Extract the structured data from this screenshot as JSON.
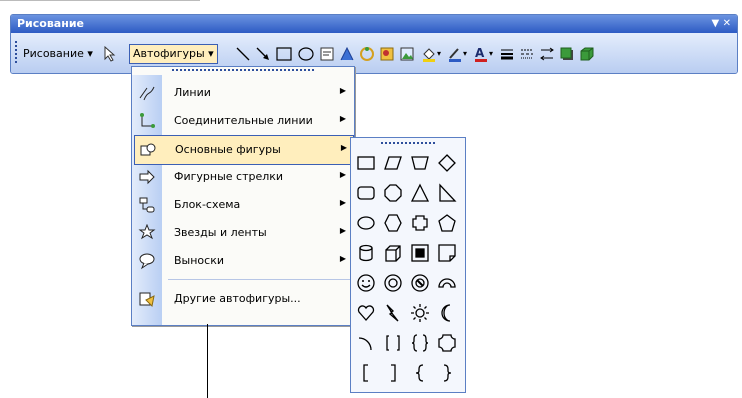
{
  "toolbar": {
    "title": "Рисование",
    "drawing_menu": "Рисование",
    "autoshapes_menu": "Автофигуры",
    "title_controls": "▼ ✕"
  },
  "menu": {
    "items": [
      {
        "label": "Линии",
        "icon": "lines-icon",
        "submenu": true
      },
      {
        "label": "Соединительные линии",
        "icon": "connectors-icon",
        "submenu": true
      },
      {
        "label": "Основные фигуры",
        "icon": "basic-shapes-icon",
        "submenu": true,
        "selected": true
      },
      {
        "label": "Фигурные стрелки",
        "icon": "block-arrows-icon",
        "submenu": true
      },
      {
        "label": "Блок-схема",
        "icon": "flowchart-icon",
        "submenu": true
      },
      {
        "label": "Звезды и ленты",
        "icon": "stars-banners-icon",
        "submenu": true
      },
      {
        "label": "Выноски",
        "icon": "callouts-icon",
        "submenu": true
      },
      {
        "label": "Другие автофигуры...",
        "icon": "more-autoshapes-icon",
        "submenu": false
      }
    ]
  },
  "palette": {
    "shapes": [
      "rectangle",
      "parallelogram",
      "trapezoid",
      "diamond",
      "rounded-rectangle",
      "octagon",
      "isosceles-triangle",
      "right-triangle",
      "oval",
      "hexagon",
      "cross",
      "pentagon",
      "can",
      "cube",
      "bevel",
      "folded-corner",
      "smiley-face",
      "donut",
      "no-symbol",
      "block-arc",
      "heart",
      "lightning-bolt",
      "sun",
      "moon",
      "arc",
      "double-bracket",
      "double-brace",
      "plaque",
      "left-bracket",
      "right-bracket",
      "left-brace",
      "right-brace"
    ]
  },
  "colors": {
    "accent": "#2d5bc4",
    "highlight": "#ffeebd",
    "toolbar_bg": "#c9daf6"
  }
}
